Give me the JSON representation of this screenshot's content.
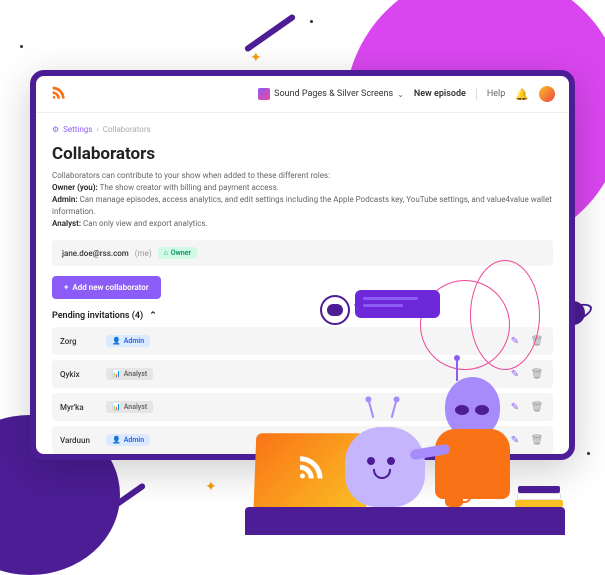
{
  "topbar": {
    "show_name": "Sound Pages & Silver Screens",
    "new_episode": "New episode",
    "help": "Help"
  },
  "breadcrumb": {
    "settings": "Settings",
    "current": "Collaborators"
  },
  "page": {
    "title": "Collaborators",
    "intro": "Collaborators can contribute to your show when added to these different roles:",
    "owner_label": "Owner (you):",
    "owner_desc": " The show creator with billing and payment access.",
    "admin_label": "Admin:",
    "admin_desc": " Can manage episodes, access analytics, and edit settings including the Apple Podcasts key, YouTube settings, and value4value wallet information.",
    "analyst_label": "Analyst:",
    "analyst_desc": " Can only view and export analytics."
  },
  "owner_row": {
    "email": "jane.doe@rss.com",
    "me": "(me)",
    "badge": "Owner"
  },
  "add_button": "Add new collaborator",
  "pending": {
    "header": "Pending invitations (4)",
    "items": [
      {
        "name": "Zorg",
        "role": "Admin",
        "role_type": "admin"
      },
      {
        "name": "Qykix",
        "role": "Analyst",
        "role_type": "analyst"
      },
      {
        "name": "Myr'ka",
        "role": "Analyst",
        "role_type": "analyst"
      },
      {
        "name": "Varduun",
        "role": "Admin",
        "role_type": "admin"
      }
    ]
  }
}
